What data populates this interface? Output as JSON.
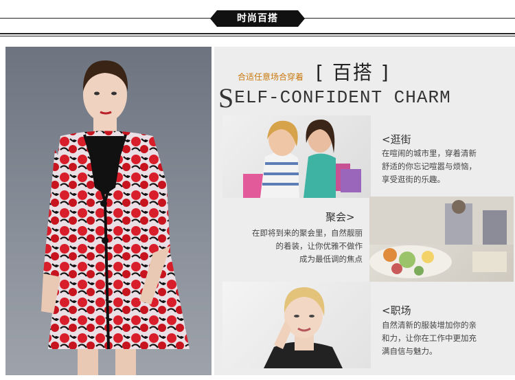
{
  "header": {
    "badge_label": "时尚百搭"
  },
  "hero": {
    "subtitle": "合适任意场合穿着",
    "title_cn": "[ 百搭 ]",
    "title_en_initial": "S",
    "title_en_rest": "ELF-CONFIDENT CHARM"
  },
  "sections": [
    {
      "title": "<逛街",
      "body_lines": [
        "在喧闹的城市里，穿着清新",
        "舒适的你忘记喧嚣与烦恼，",
        "享受逛街的乐趣。"
      ]
    },
    {
      "title": "聚会>",
      "body_lines": [
        "在即将到来的聚会里，自然靓丽",
        "的着装，让你优雅不做作",
        "成为最低调的焦点"
      ]
    },
    {
      "title": "<职场",
      "body_lines": [
        "自然清新的服装增加你的亲",
        "和力，让你在工作中更加充",
        "满自信与魅力。"
      ]
    }
  ],
  "colors": {
    "accent": "#c9790e",
    "coat_red": "#d81e2a",
    "badge_bg": "#111111"
  }
}
